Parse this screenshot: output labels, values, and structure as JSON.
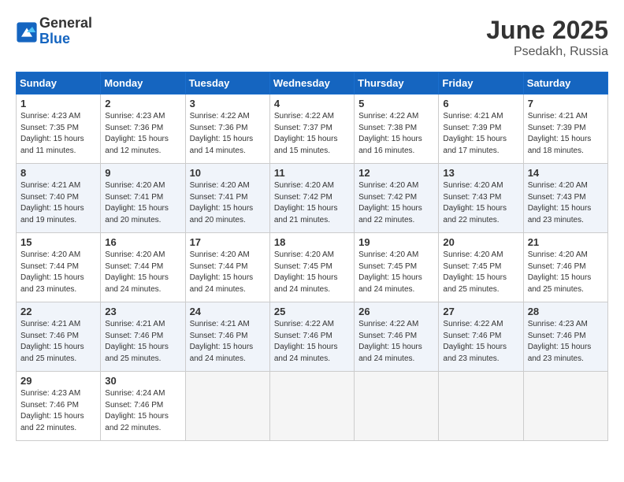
{
  "header": {
    "logo": {
      "general": "General",
      "blue": "Blue"
    },
    "title": "June 2025",
    "location": "Psedakh, Russia"
  },
  "weekdays": [
    "Sunday",
    "Monday",
    "Tuesday",
    "Wednesday",
    "Thursday",
    "Friday",
    "Saturday"
  ],
  "weeks": [
    [
      {
        "day": "1",
        "sunrise": "Sunrise: 4:23 AM",
        "sunset": "Sunset: 7:35 PM",
        "daylight": "Daylight: 15 hours and 11 minutes."
      },
      {
        "day": "2",
        "sunrise": "Sunrise: 4:23 AM",
        "sunset": "Sunset: 7:36 PM",
        "daylight": "Daylight: 15 hours and 12 minutes."
      },
      {
        "day": "3",
        "sunrise": "Sunrise: 4:22 AM",
        "sunset": "Sunset: 7:36 PM",
        "daylight": "Daylight: 15 hours and 14 minutes."
      },
      {
        "day": "4",
        "sunrise": "Sunrise: 4:22 AM",
        "sunset": "Sunset: 7:37 PM",
        "daylight": "Daylight: 15 hours and 15 minutes."
      },
      {
        "day": "5",
        "sunrise": "Sunrise: 4:22 AM",
        "sunset": "Sunset: 7:38 PM",
        "daylight": "Daylight: 15 hours and 16 minutes."
      },
      {
        "day": "6",
        "sunrise": "Sunrise: 4:21 AM",
        "sunset": "Sunset: 7:39 PM",
        "daylight": "Daylight: 15 hours and 17 minutes."
      },
      {
        "day": "7",
        "sunrise": "Sunrise: 4:21 AM",
        "sunset": "Sunset: 7:39 PM",
        "daylight": "Daylight: 15 hours and 18 minutes."
      }
    ],
    [
      {
        "day": "8",
        "sunrise": "Sunrise: 4:21 AM",
        "sunset": "Sunset: 7:40 PM",
        "daylight": "Daylight: 15 hours and 19 minutes."
      },
      {
        "day": "9",
        "sunrise": "Sunrise: 4:20 AM",
        "sunset": "Sunset: 7:41 PM",
        "daylight": "Daylight: 15 hours and 20 minutes."
      },
      {
        "day": "10",
        "sunrise": "Sunrise: 4:20 AM",
        "sunset": "Sunset: 7:41 PM",
        "daylight": "Daylight: 15 hours and 20 minutes."
      },
      {
        "day": "11",
        "sunrise": "Sunrise: 4:20 AM",
        "sunset": "Sunset: 7:42 PM",
        "daylight": "Daylight: 15 hours and 21 minutes."
      },
      {
        "day": "12",
        "sunrise": "Sunrise: 4:20 AM",
        "sunset": "Sunset: 7:42 PM",
        "daylight": "Daylight: 15 hours and 22 minutes."
      },
      {
        "day": "13",
        "sunrise": "Sunrise: 4:20 AM",
        "sunset": "Sunset: 7:43 PM",
        "daylight": "Daylight: 15 hours and 22 minutes."
      },
      {
        "day": "14",
        "sunrise": "Sunrise: 4:20 AM",
        "sunset": "Sunset: 7:43 PM",
        "daylight": "Daylight: 15 hours and 23 minutes."
      }
    ],
    [
      {
        "day": "15",
        "sunrise": "Sunrise: 4:20 AM",
        "sunset": "Sunset: 7:44 PM",
        "daylight": "Daylight: 15 hours and 23 minutes."
      },
      {
        "day": "16",
        "sunrise": "Sunrise: 4:20 AM",
        "sunset": "Sunset: 7:44 PM",
        "daylight": "Daylight: 15 hours and 24 minutes."
      },
      {
        "day": "17",
        "sunrise": "Sunrise: 4:20 AM",
        "sunset": "Sunset: 7:44 PM",
        "daylight": "Daylight: 15 hours and 24 minutes."
      },
      {
        "day": "18",
        "sunrise": "Sunrise: 4:20 AM",
        "sunset": "Sunset: 7:45 PM",
        "daylight": "Daylight: 15 hours and 24 minutes."
      },
      {
        "day": "19",
        "sunrise": "Sunrise: 4:20 AM",
        "sunset": "Sunset: 7:45 PM",
        "daylight": "Daylight: 15 hours and 24 minutes."
      },
      {
        "day": "20",
        "sunrise": "Sunrise: 4:20 AM",
        "sunset": "Sunset: 7:45 PM",
        "daylight": "Daylight: 15 hours and 25 minutes."
      },
      {
        "day": "21",
        "sunrise": "Sunrise: 4:20 AM",
        "sunset": "Sunset: 7:46 PM",
        "daylight": "Daylight: 15 hours and 25 minutes."
      }
    ],
    [
      {
        "day": "22",
        "sunrise": "Sunrise: 4:21 AM",
        "sunset": "Sunset: 7:46 PM",
        "daylight": "Daylight: 15 hours and 25 minutes."
      },
      {
        "day": "23",
        "sunrise": "Sunrise: 4:21 AM",
        "sunset": "Sunset: 7:46 PM",
        "daylight": "Daylight: 15 hours and 25 minutes."
      },
      {
        "day": "24",
        "sunrise": "Sunrise: 4:21 AM",
        "sunset": "Sunset: 7:46 PM",
        "daylight": "Daylight: 15 hours and 24 minutes."
      },
      {
        "day": "25",
        "sunrise": "Sunrise: 4:22 AM",
        "sunset": "Sunset: 7:46 PM",
        "daylight": "Daylight: 15 hours and 24 minutes."
      },
      {
        "day": "26",
        "sunrise": "Sunrise: 4:22 AM",
        "sunset": "Sunset: 7:46 PM",
        "daylight": "Daylight: 15 hours and 24 minutes."
      },
      {
        "day": "27",
        "sunrise": "Sunrise: 4:22 AM",
        "sunset": "Sunset: 7:46 PM",
        "daylight": "Daylight: 15 hours and 23 minutes."
      },
      {
        "day": "28",
        "sunrise": "Sunrise: 4:23 AM",
        "sunset": "Sunset: 7:46 PM",
        "daylight": "Daylight: 15 hours and 23 minutes."
      }
    ],
    [
      {
        "day": "29",
        "sunrise": "Sunrise: 4:23 AM",
        "sunset": "Sunset: 7:46 PM",
        "daylight": "Daylight: 15 hours and 22 minutes."
      },
      {
        "day": "30",
        "sunrise": "Sunrise: 4:24 AM",
        "sunset": "Sunset: 7:46 PM",
        "daylight": "Daylight: 15 hours and 22 minutes."
      },
      null,
      null,
      null,
      null,
      null
    ]
  ]
}
